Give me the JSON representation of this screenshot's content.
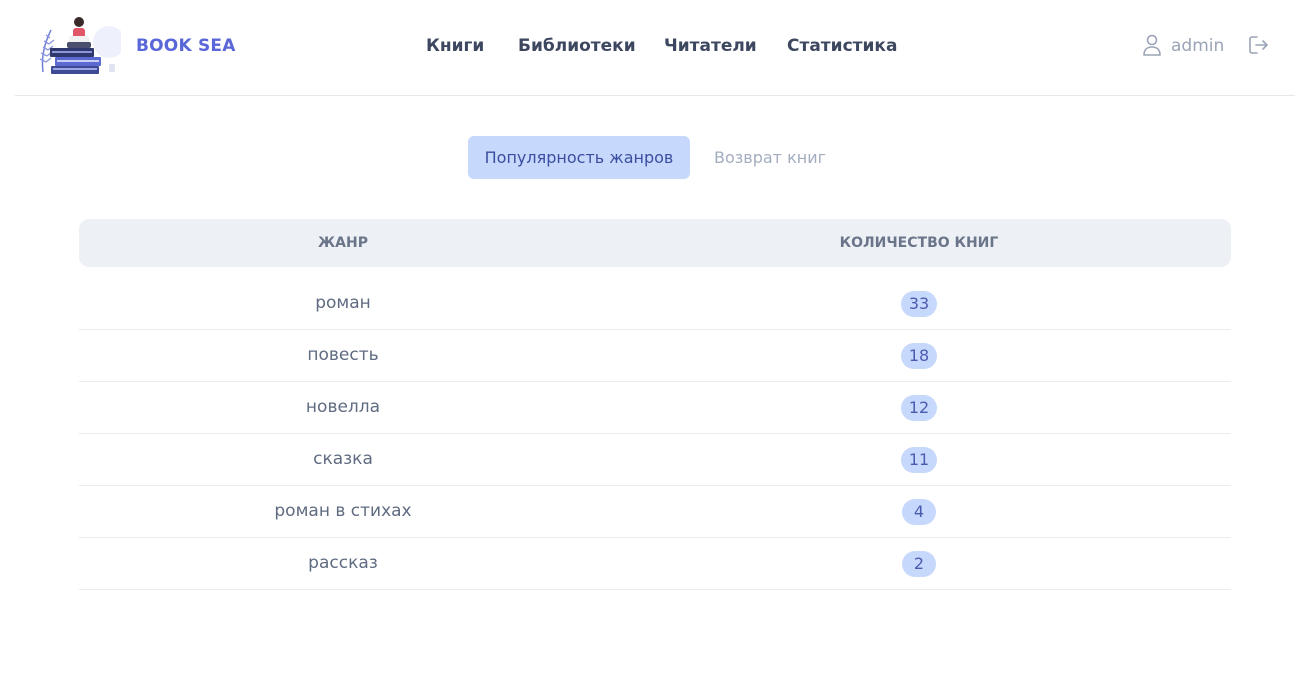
{
  "header": {
    "brand": "BOOK SEA",
    "nav": [
      "Книги",
      "Библиотеки",
      "Читатели",
      "Статистика"
    ],
    "user": "admin",
    "icons": {
      "user": "user-icon",
      "logout": "logout-icon",
      "logo": "book-stack-logo"
    }
  },
  "tabs": {
    "active": "Популярность жанров",
    "inactive": "Возврат книг"
  },
  "table": {
    "columns": [
      "ЖАНР",
      "КОЛИЧЕСТВО КНИГ"
    ],
    "rows": [
      {
        "genre": "роман",
        "count": "33"
      },
      {
        "genre": "повесть",
        "count": "18"
      },
      {
        "genre": "новелла",
        "count": "12"
      },
      {
        "genre": "сказка",
        "count": "11"
      },
      {
        "genre": "роман в стихах",
        "count": "4"
      },
      {
        "genre": "рассказ",
        "count": "2"
      }
    ]
  },
  "colors": {
    "brand": "#5a67d8",
    "accent_bg": "#c6d8fb",
    "header_row_bg": "#edf1f6"
  }
}
